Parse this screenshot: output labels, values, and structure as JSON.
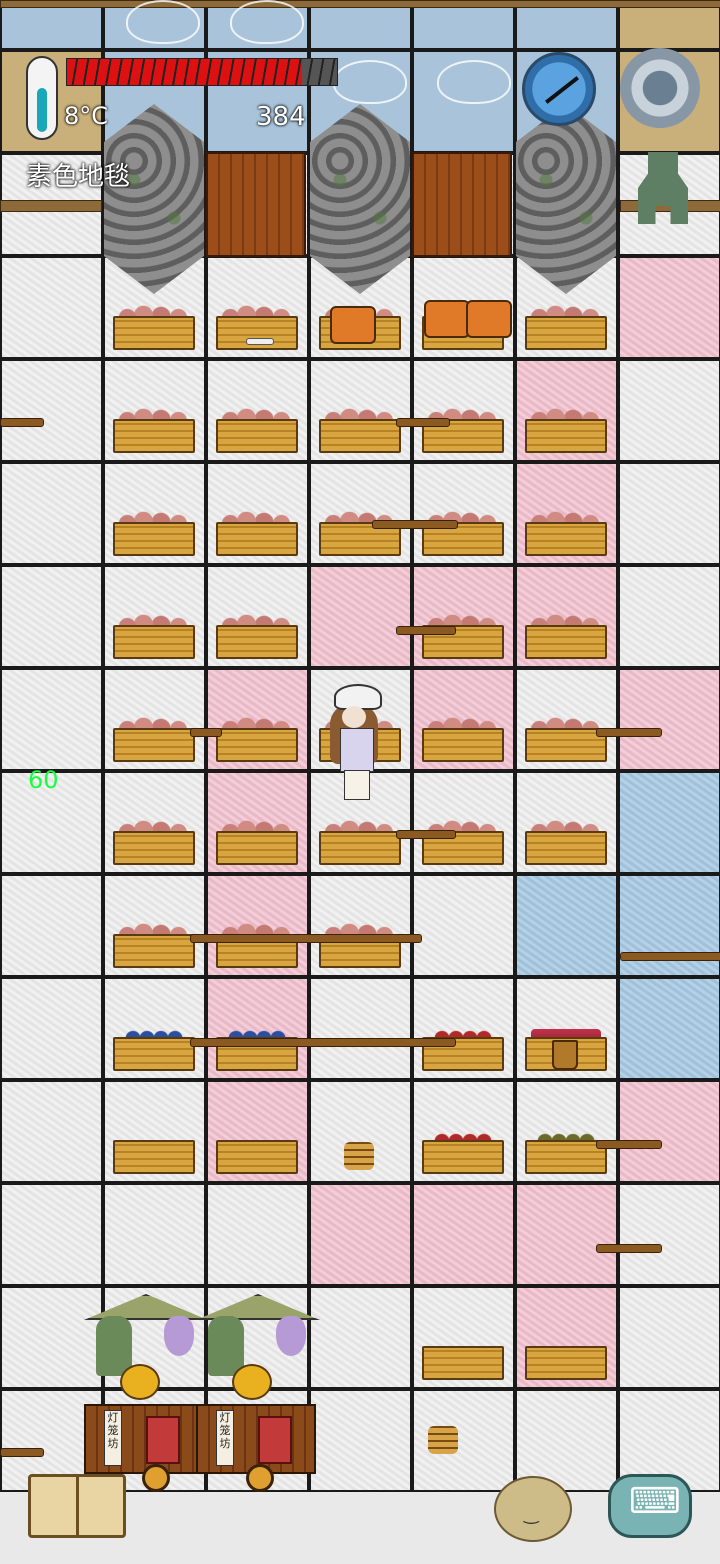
{
  "hud": {
    "temperature": "8°C",
    "floor_label": "素色地毯",
    "score": "384",
    "fps": "60",
    "health_fraction": 0.87
  },
  "stall": {
    "sign_text": "灯笼坊"
  },
  "icons": [
    "thermometer-icon",
    "compass-icon",
    "gear-icon",
    "coin-icon",
    "book-icon",
    "keyboard-icon",
    "potato-icon"
  ],
  "colors": {
    "health": "#dd1111",
    "fps": "#19ff40",
    "pink_tile": "#f3cdd8",
    "blue_tile": "#b5d1e6",
    "white_tile": "#eeeeee"
  },
  "grid": {
    "rows": [
      [
        "sky",
        "sky",
        "sky",
        "sky",
        "sky",
        "sky",
        "dirt"
      ],
      [
        "dirt",
        "sky",
        "sky",
        "sky",
        "sky",
        "sky",
        "dirt"
      ],
      [
        "white",
        "white",
        "white",
        "white",
        "white",
        "white",
        "white"
      ],
      [
        "white",
        "white",
        "white",
        "white",
        "white",
        "white",
        "pink"
      ],
      [
        "white",
        "white",
        "white",
        "white",
        "white",
        "pink",
        "white"
      ],
      [
        "white",
        "white",
        "white",
        "white",
        "white",
        "pink",
        "white"
      ],
      [
        "white",
        "white",
        "white",
        "pink",
        "pink",
        "pink",
        "white"
      ],
      [
        "white",
        "white",
        "pink",
        "white",
        "pink",
        "white",
        "pink"
      ],
      [
        "white",
        "white",
        "pink",
        "white",
        "white",
        "white",
        "blue"
      ],
      [
        "white",
        "white",
        "pink",
        "white",
        "white",
        "blue",
        "blue"
      ],
      [
        "white",
        "white",
        "pink",
        "white",
        "white",
        "white",
        "blue"
      ],
      [
        "white",
        "white",
        "pink",
        "white",
        "white",
        "white",
        "pink"
      ],
      [
        "white",
        "white",
        "white",
        "pink",
        "pink",
        "pink",
        "white"
      ],
      [
        "white",
        "white",
        "white",
        "white",
        "white",
        "pink",
        "white"
      ],
      [
        "white",
        "white",
        "white",
        "white",
        "white",
        "white",
        "white"
      ]
    ],
    "crates": [
      {
        "row": 3,
        "col": 1,
        "goods": "chicken"
      },
      {
        "row": 3,
        "col": 2,
        "goods": "chicken"
      },
      {
        "row": 3,
        "col": 3,
        "goods": "chicken"
      },
      {
        "row": 3,
        "col": 4,
        "goods": "chicken"
      },
      {
        "row": 3,
        "col": 5,
        "goods": "chicken"
      },
      {
        "row": 4,
        "col": 1,
        "goods": "chicken"
      },
      {
        "row": 4,
        "col": 2,
        "goods": "chicken"
      },
      {
        "row": 4,
        "col": 3,
        "goods": "chicken"
      },
      {
        "row": 4,
        "col": 4,
        "goods": "chicken"
      },
      {
        "row": 4,
        "col": 5,
        "goods": "chicken"
      },
      {
        "row": 5,
        "col": 1,
        "goods": "chicken"
      },
      {
        "row": 5,
        "col": 2,
        "goods": "chicken"
      },
      {
        "row": 5,
        "col": 3,
        "goods": "chicken"
      },
      {
        "row": 5,
        "col": 4,
        "goods": "chicken"
      },
      {
        "row": 5,
        "col": 5,
        "goods": "chicken"
      },
      {
        "row": 6,
        "col": 1,
        "goods": "chicken"
      },
      {
        "row": 6,
        "col": 2,
        "goods": "chicken"
      },
      {
        "row": 6,
        "col": 4,
        "goods": "chicken"
      },
      {
        "row": 6,
        "col": 5,
        "goods": "chicken"
      },
      {
        "row": 7,
        "col": 1,
        "goods": "chicken"
      },
      {
        "row": 7,
        "col": 2,
        "goods": "chicken"
      },
      {
        "row": 7,
        "col": 3,
        "goods": "chicken"
      },
      {
        "row": 7,
        "col": 4,
        "goods": "chicken"
      },
      {
        "row": 7,
        "col": 5,
        "goods": "chicken"
      },
      {
        "row": 8,
        "col": 1,
        "goods": "chicken"
      },
      {
        "row": 8,
        "col": 2,
        "goods": "chicken"
      },
      {
        "row": 8,
        "col": 3,
        "goods": "chicken"
      },
      {
        "row": 8,
        "col": 4,
        "goods": "chicken"
      },
      {
        "row": 8,
        "col": 5,
        "goods": "chicken"
      },
      {
        "row": 9,
        "col": 1,
        "goods": "chicken"
      },
      {
        "row": 9,
        "col": 2,
        "goods": "chicken"
      },
      {
        "row": 9,
        "col": 3,
        "goods": "chicken"
      },
      {
        "row": 10,
        "col": 1,
        "goods": "blue"
      },
      {
        "row": 10,
        "col": 2,
        "goods": "blue"
      },
      {
        "row": 10,
        "col": 4,
        "goods": "red"
      },
      {
        "row": 10,
        "col": 5,
        "goods": "meat"
      },
      {
        "row": 11,
        "col": 1,
        "goods": "none"
      },
      {
        "row": 11,
        "col": 2,
        "goods": "none"
      },
      {
        "row": 11,
        "col": 4,
        "goods": "red"
      },
      {
        "row": 11,
        "col": 5,
        "goods": "green"
      },
      {
        "row": 13,
        "col": 4,
        "goods": "none"
      },
      {
        "row": 13,
        "col": 5,
        "goods": "none"
      }
    ]
  }
}
